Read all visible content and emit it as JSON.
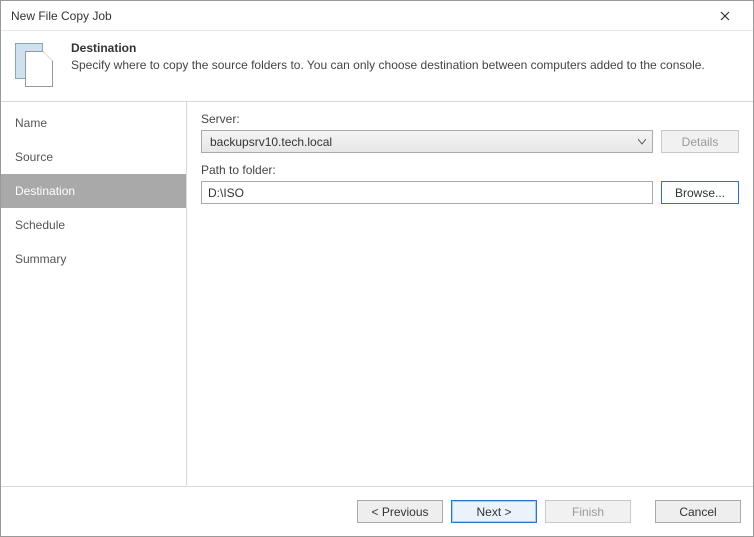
{
  "window": {
    "title": "New File Copy Job"
  },
  "header": {
    "title": "Destination",
    "description": "Specify where to copy the source folders to. You can only choose destination between computers added to the console."
  },
  "sidebar": {
    "steps": [
      {
        "label": "Name",
        "active": false
      },
      {
        "label": "Source",
        "active": false
      },
      {
        "label": "Destination",
        "active": true
      },
      {
        "label": "Schedule",
        "active": false
      },
      {
        "label": "Summary",
        "active": false
      }
    ]
  },
  "form": {
    "serverLabel": "Server:",
    "serverValue": "backupsrv10.tech.local",
    "detailsButton": "Details",
    "pathLabel": "Path to folder:",
    "pathValue": "D:\\ISO",
    "browseButton": "Browse..."
  },
  "footer": {
    "previous": "< Previous",
    "next": "Next >",
    "finish": "Finish",
    "cancel": "Cancel"
  }
}
